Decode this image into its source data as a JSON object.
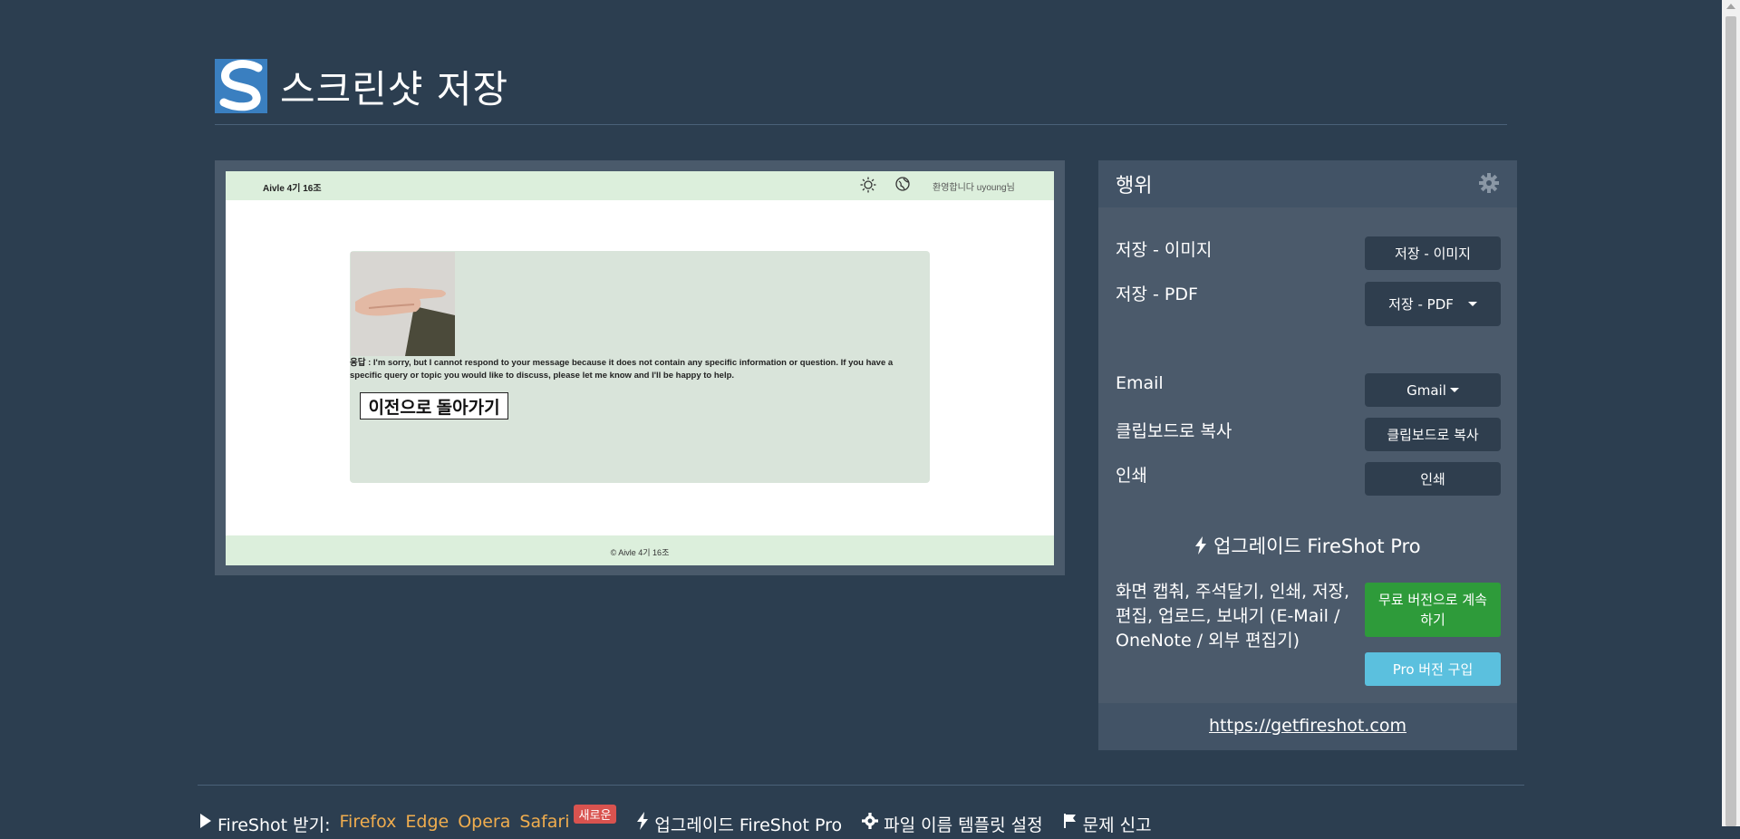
{
  "header": {
    "title": "스크린샷 저장"
  },
  "preview": {
    "brand": "Aivle 4기 16조",
    "welcome": "환영합니다 uyoung님",
    "answer": "응답 : I'm sorry, but I cannot respond to your message because it does not contain any specific information or question. If you have a specific query or topic you would like to discuss, please let me know and I'll be happy to help.",
    "back_button": "이전으로 돌아가기",
    "footer": "© Aivle 4기 16조"
  },
  "panel": {
    "title": "행위",
    "rows": {
      "image": {
        "label": "저장 - 이미지",
        "button": "저장 - 이미지"
      },
      "pdf": {
        "label": "저장 - PDF",
        "button": "저장 - PDF"
      },
      "email": {
        "label": "Email",
        "button": "Gmail"
      },
      "clipboard": {
        "label": "클립보드로 복사",
        "button": "클립보드로 복사"
      },
      "print": {
        "label": "인쇄",
        "button": "인쇄"
      }
    },
    "upgrade": {
      "heading": "업그레이드 FireShot Pro",
      "description": "화면 캡춰, 주석달기, 인쇄, 저장, 편집, 업로드, 보내기 (E-Mail / OneNote / 외부 편집기)",
      "continue_button": "무료 버전으로 계속하기",
      "buy_button": "Pro 버전 구입"
    },
    "link": "https://getfireshot.com"
  },
  "bottom": {
    "get_label": "FireShot 받기:",
    "browsers": [
      "Firefox",
      "Edge",
      "Opera",
      "Safari"
    ],
    "new_badge": "새로운",
    "upgrade": "업그레이드 FireShot Pro",
    "template": "파일 이름 템플릿 설정",
    "report": "문제 신고"
  },
  "colors": {
    "background": "#2c3e50",
    "panel": "#4b5a6b",
    "green": "#2e9b3a",
    "blue": "#5bc0de",
    "link": "#f0ad4e"
  }
}
